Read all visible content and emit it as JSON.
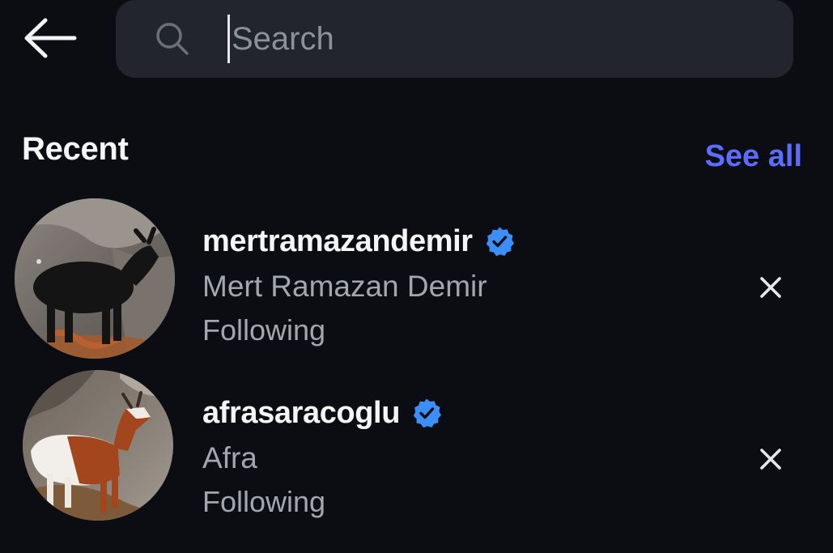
{
  "header": {
    "back_icon": "arrow-left-icon",
    "search": {
      "icon": "search-icon",
      "placeholder": "Search",
      "value": ""
    }
  },
  "recent": {
    "title": "Recent",
    "see_all_label": "See all",
    "accent_color": "#5b6dff",
    "items": [
      {
        "username": "mertramazandemir",
        "full_name": "Mert Ramazan Demir",
        "status": "Following",
        "verified": true,
        "avatar": "black-goat-photo"
      },
      {
        "username": "afrasaracoglu",
        "full_name": "Afra",
        "status": "Following",
        "verified": true,
        "avatar": "brown-white-goat-photo"
      }
    ]
  },
  "colors": {
    "background": "#0b0d12",
    "search_bar": "#22252d",
    "verified_badge": "#3b8ff6",
    "secondary_text": "#a2a6ad"
  }
}
